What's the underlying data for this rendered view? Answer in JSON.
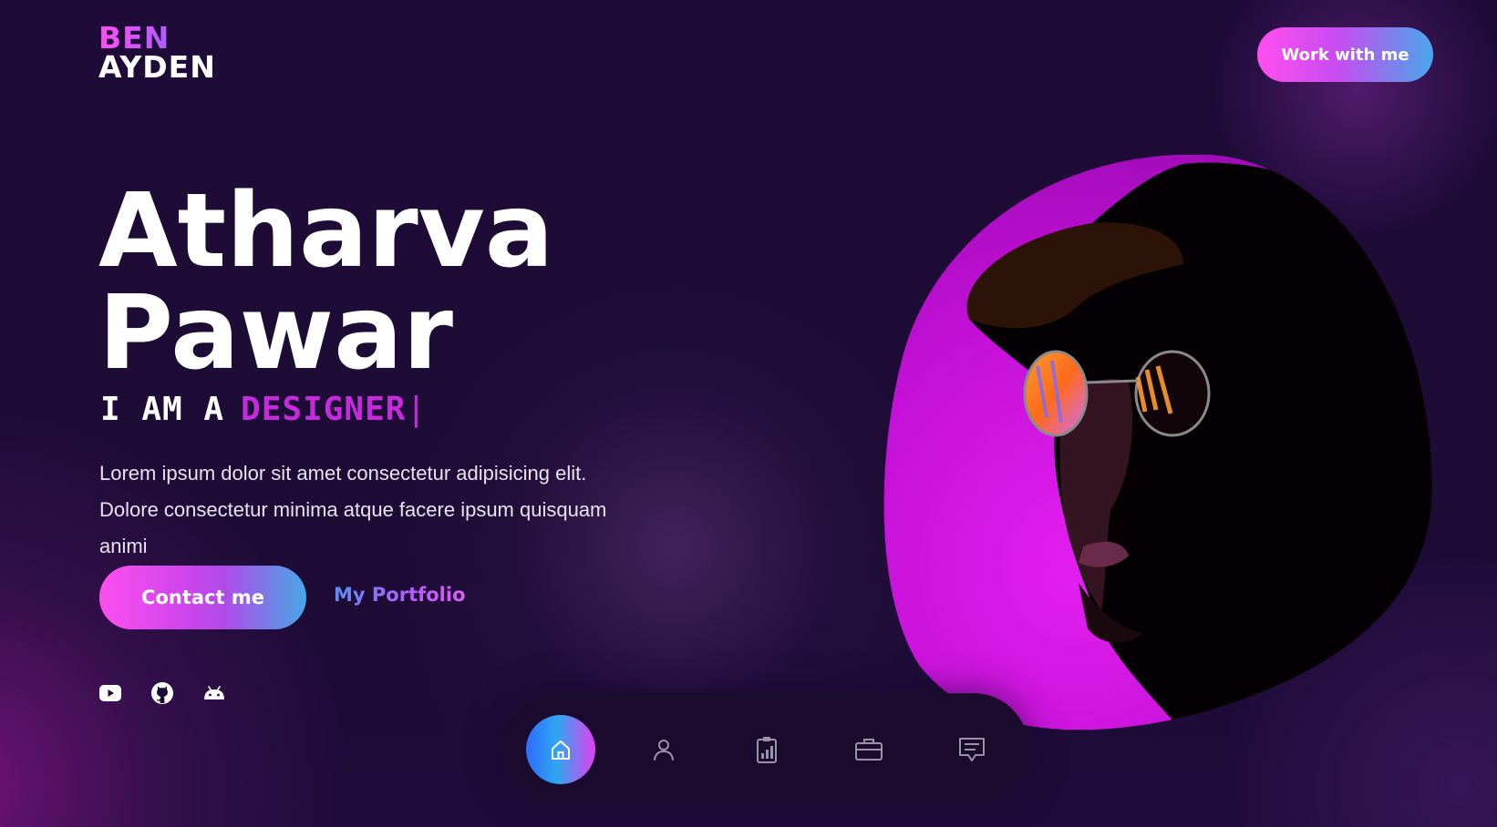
{
  "brand": {
    "line1": "BEN",
    "line2": "AYDEN"
  },
  "header": {
    "cta_label": "Work with me"
  },
  "hero": {
    "name_line1": "Atharva",
    "name_line2": "Pawar",
    "role_prefix": "I AM A",
    "role_word": "DESIGNER",
    "role_cursor": "|",
    "description": "Lorem ipsum dolor sit amet consectetur adipisicing elit. Dolore consectetur minima atque facere ipsum quisquam animi",
    "contact_label": "Contact me",
    "portfolio_label": "My Portfolio"
  },
  "socials": [
    {
      "icon": "youtube-icon"
    },
    {
      "icon": "github-icon"
    },
    {
      "icon": "android-icon"
    }
  ],
  "navbar": {
    "items": [
      {
        "icon": "home-icon",
        "active": true
      },
      {
        "icon": "user-icon",
        "active": false
      },
      {
        "icon": "clipboard-chart-icon",
        "active": false
      },
      {
        "icon": "briefcase-icon",
        "active": false
      },
      {
        "icon": "message-icon",
        "active": false
      }
    ]
  },
  "colors": {
    "background": "#1c0c33",
    "accent_pink": "#ff4ff0",
    "accent_purple": "#c52bdc",
    "accent_blue": "#46a8e6",
    "blob_magenta": "#d11ae0"
  }
}
